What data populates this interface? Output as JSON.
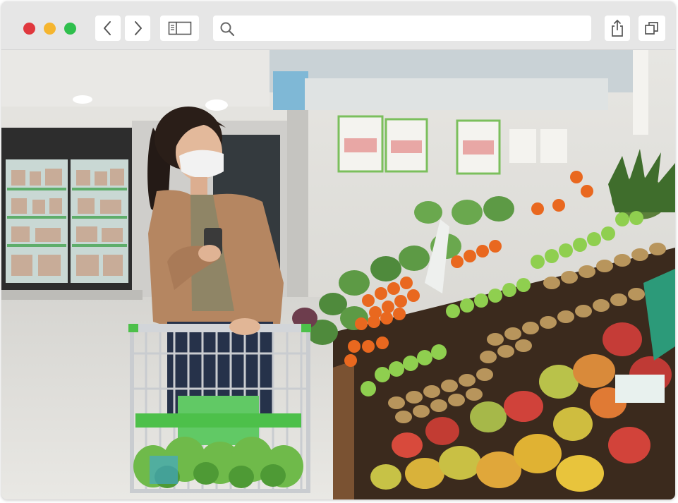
{
  "browser": {
    "traffic_lights": {
      "close": "#e0383e",
      "minimize": "#f5b52f",
      "maximize": "#2fbf4d"
    },
    "toolbar_background": "#e6e6e6",
    "buttons": {
      "back": {
        "icon": "chevron-left-icon"
      },
      "forward": {
        "icon": "chevron-right-icon"
      },
      "sidebar": {
        "icon": "sidebar-icon"
      },
      "share": {
        "icon": "share-icon"
      },
      "tabs": {
        "icon": "tabs-icon"
      }
    },
    "address_bar": {
      "value": "",
      "icon": "search-icon"
    }
  },
  "content": {
    "image": "supermarket-photo"
  }
}
